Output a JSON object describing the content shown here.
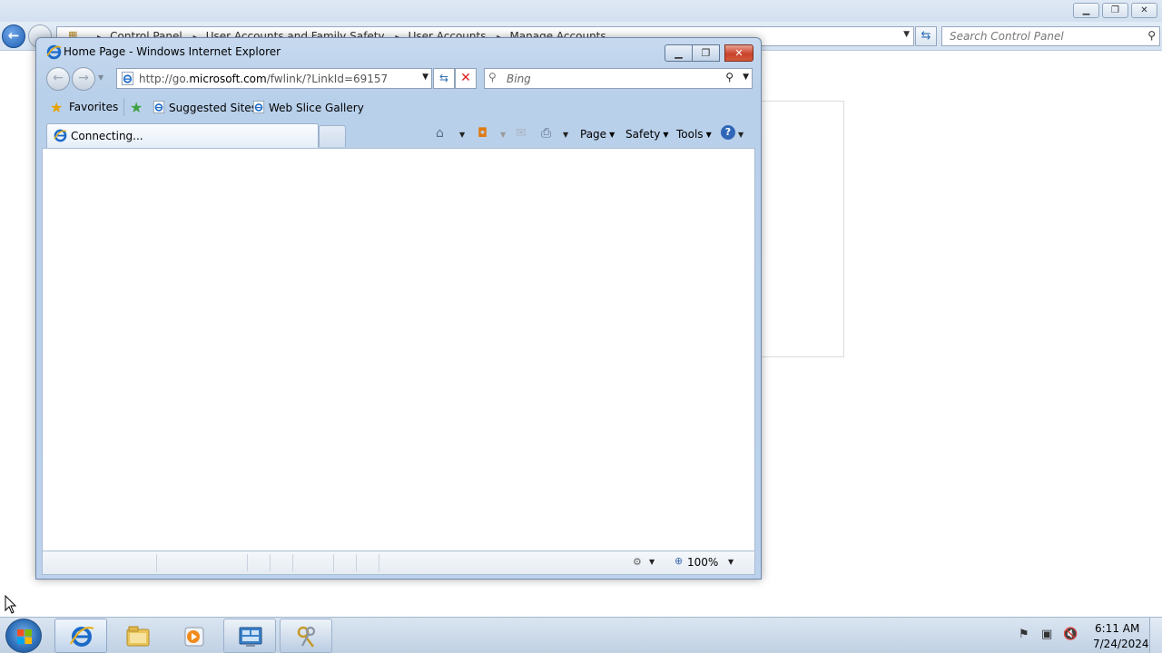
{
  "control_panel": {
    "breadcrumb": [
      "Control Panel",
      "User Accounts and Family Safety",
      "User Accounts",
      "Manage Accounts"
    ],
    "search_placeholder": "Search Control Panel"
  },
  "ie": {
    "title": "Home Page - Windows Internet Explorer",
    "address_prefix": "http://go.",
    "address_domain": "microsoft.com",
    "address_path": "/fwlink/?LinkId=69157",
    "search_placeholder": "Bing",
    "favorites_label": "Favorites",
    "suggested_sites_label": "Suggested Sites",
    "web_slice_gallery_label": "Web Slice Gallery",
    "tab_title": "Connecting...",
    "menu_page": "Page",
    "menu_safety": "Safety",
    "menu_tools": "Tools",
    "zoom_level": "100%"
  },
  "taskbar": {
    "clock_time": "6:11 AM",
    "clock_date": "7/24/2024"
  },
  "colors": {
    "ie_frame": "#bcd2ec",
    "close_red": "#c9432c",
    "taskbar": "#c0d1e4",
    "ie_blue": "#1b6ac9"
  }
}
